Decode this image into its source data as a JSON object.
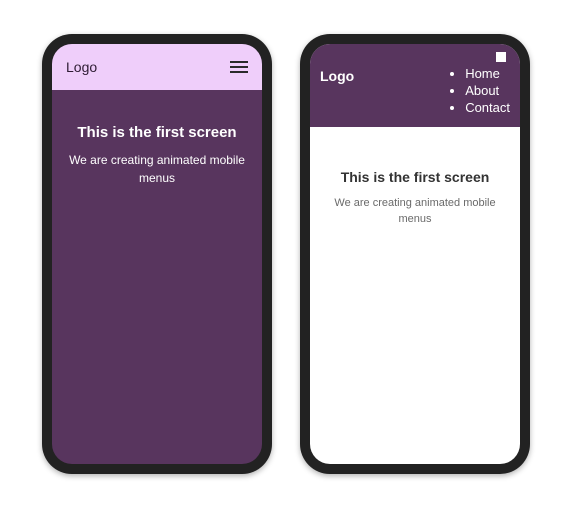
{
  "colors": {
    "darkPurple": "#58355e",
    "lightPurple": "#efcefa",
    "chassis": "#222222"
  },
  "phone1": {
    "logo": "Logo",
    "headline": "This is the first screen",
    "subline": "We are creating animated mobile menus"
  },
  "phone2": {
    "logo": "Logo",
    "menu": {
      "items": [
        "Home",
        "About",
        "Contact"
      ]
    },
    "headline": "This is the first screen",
    "subline": "We are creating animated mobile menus"
  }
}
